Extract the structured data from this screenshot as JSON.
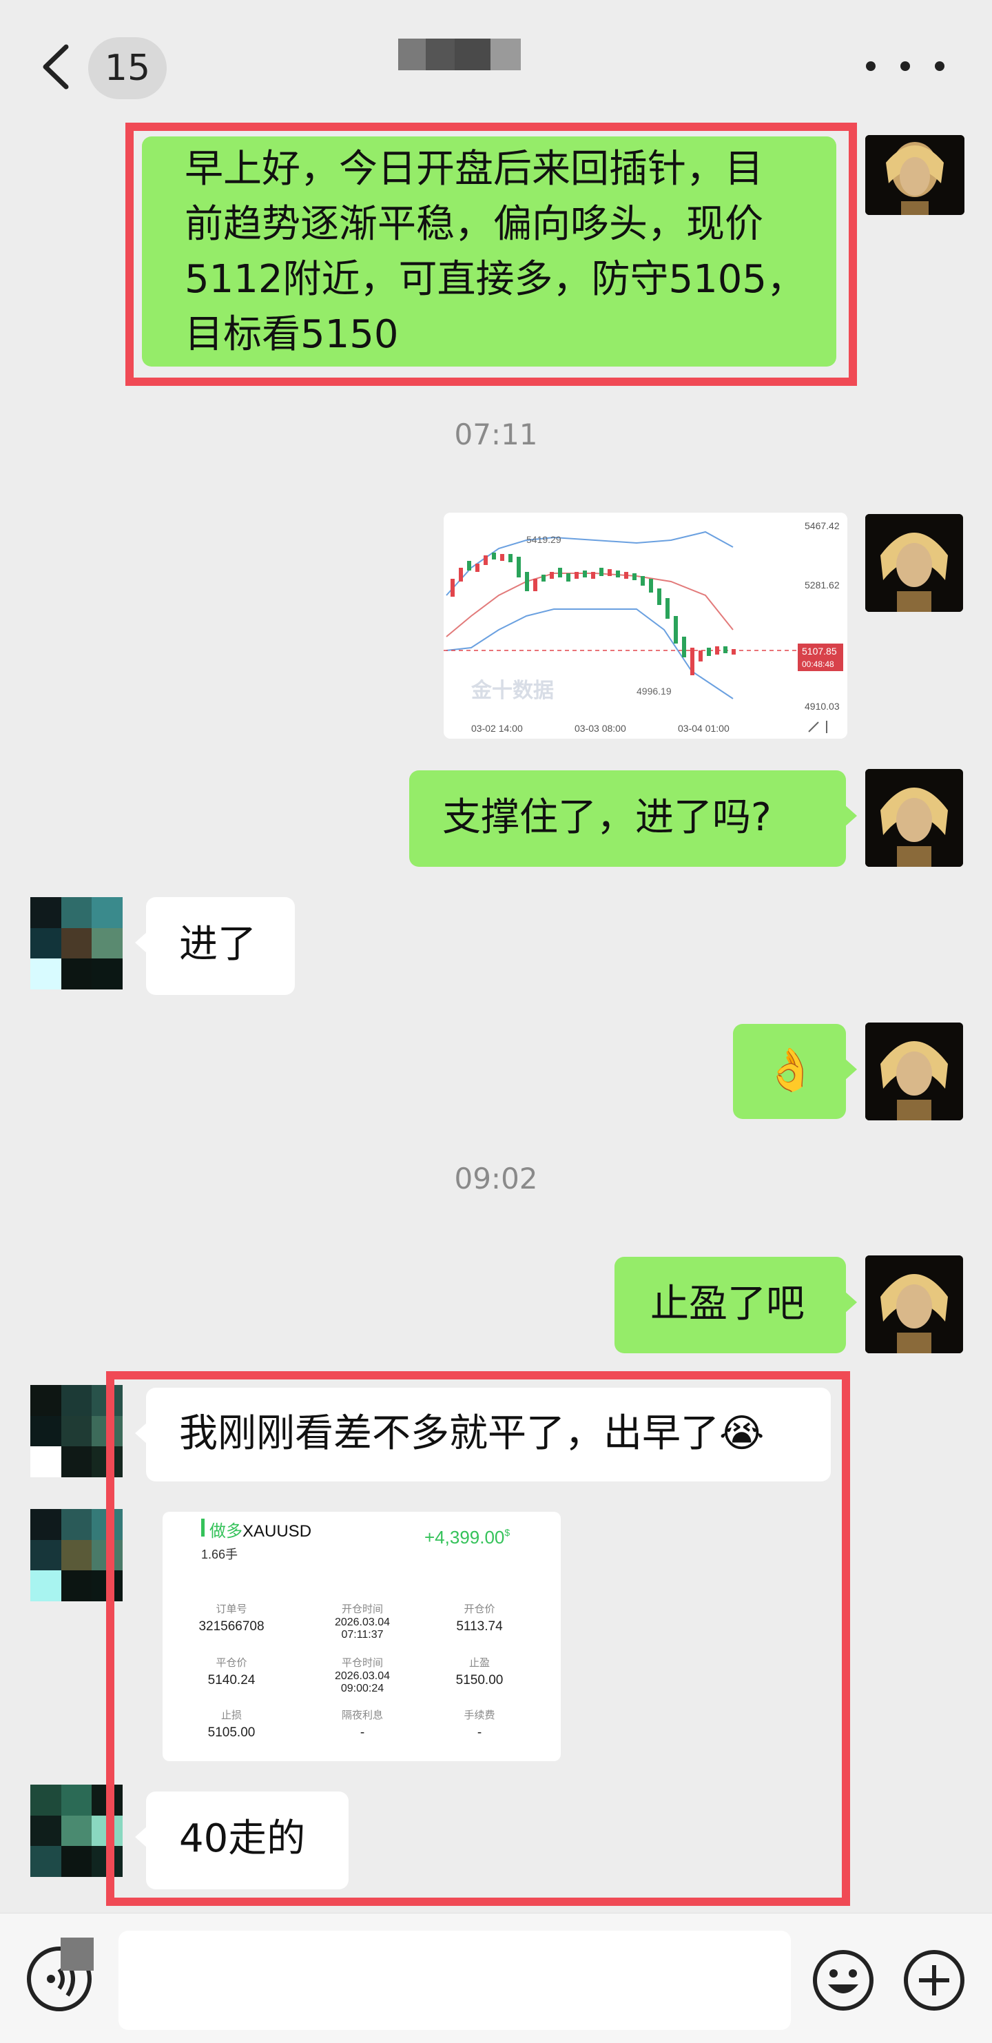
{
  "header": {
    "back_icon": "chevron-left-icon",
    "unread_count": "15",
    "more_icon": "ellipsis-icon"
  },
  "messages": {
    "m1": {
      "lines": [
        "早上好，今日开盘后来回插针，目",
        "前趋势逐渐平稳，偏向哆头，现价",
        "5112附近，可直接多，防守5105，",
        "目标看5150"
      ]
    },
    "time1": "07:11",
    "chart_image": {
      "price_labels": [
        "5467.42",
        "5281.62",
        "5107.85",
        "4910.03"
      ],
      "countdown": "00:48:48",
      "high_label": "5419.29",
      "low_label": "4996.19",
      "watermark": "金十数据",
      "x_labels": [
        "03-02 14:00",
        "03-03 08:00",
        "03-04 01:00"
      ]
    },
    "m2": "支撑住了，进了吗?",
    "m3": "进了",
    "m4": "👌",
    "time2": "09:02",
    "m5": "止盈了吧",
    "m6": "我刚刚看差不多就平了，出早了😭",
    "order": {
      "direction": "做多",
      "symbol": "XAUUSD",
      "lots": "1.66手",
      "profit": "+4,399.00",
      "profit_unit": "$",
      "fields": [
        {
          "label": "订单号",
          "value": "321566708"
        },
        {
          "label": "开仓时间",
          "value": "2026.03.04",
          "value2": "07:11:37"
        },
        {
          "label": "开仓价",
          "value": "5113.74"
        },
        {
          "label": "平仓价",
          "value": "5140.24"
        },
        {
          "label": "平仓时间",
          "value": "2026.03.04",
          "value2": "09:00:24"
        },
        {
          "label": "止盈",
          "value": "5150.00"
        },
        {
          "label": "止损",
          "value": "5105.00"
        },
        {
          "label": "隔夜利息",
          "value": "-"
        },
        {
          "label": "手续费",
          "value": "-"
        }
      ]
    },
    "m7": "40走的"
  },
  "bottom_bar": {
    "voice_icon": "voice-icon",
    "emoji_icon": "smiley-icon",
    "plus_icon": "plus-circle-icon"
  },
  "colors": {
    "background": "#ededed",
    "green_bubble": "#95ec69",
    "white_bubble": "#ffffff",
    "highlight_box": "#f04a55",
    "timestamp": "#8a8a8a"
  }
}
